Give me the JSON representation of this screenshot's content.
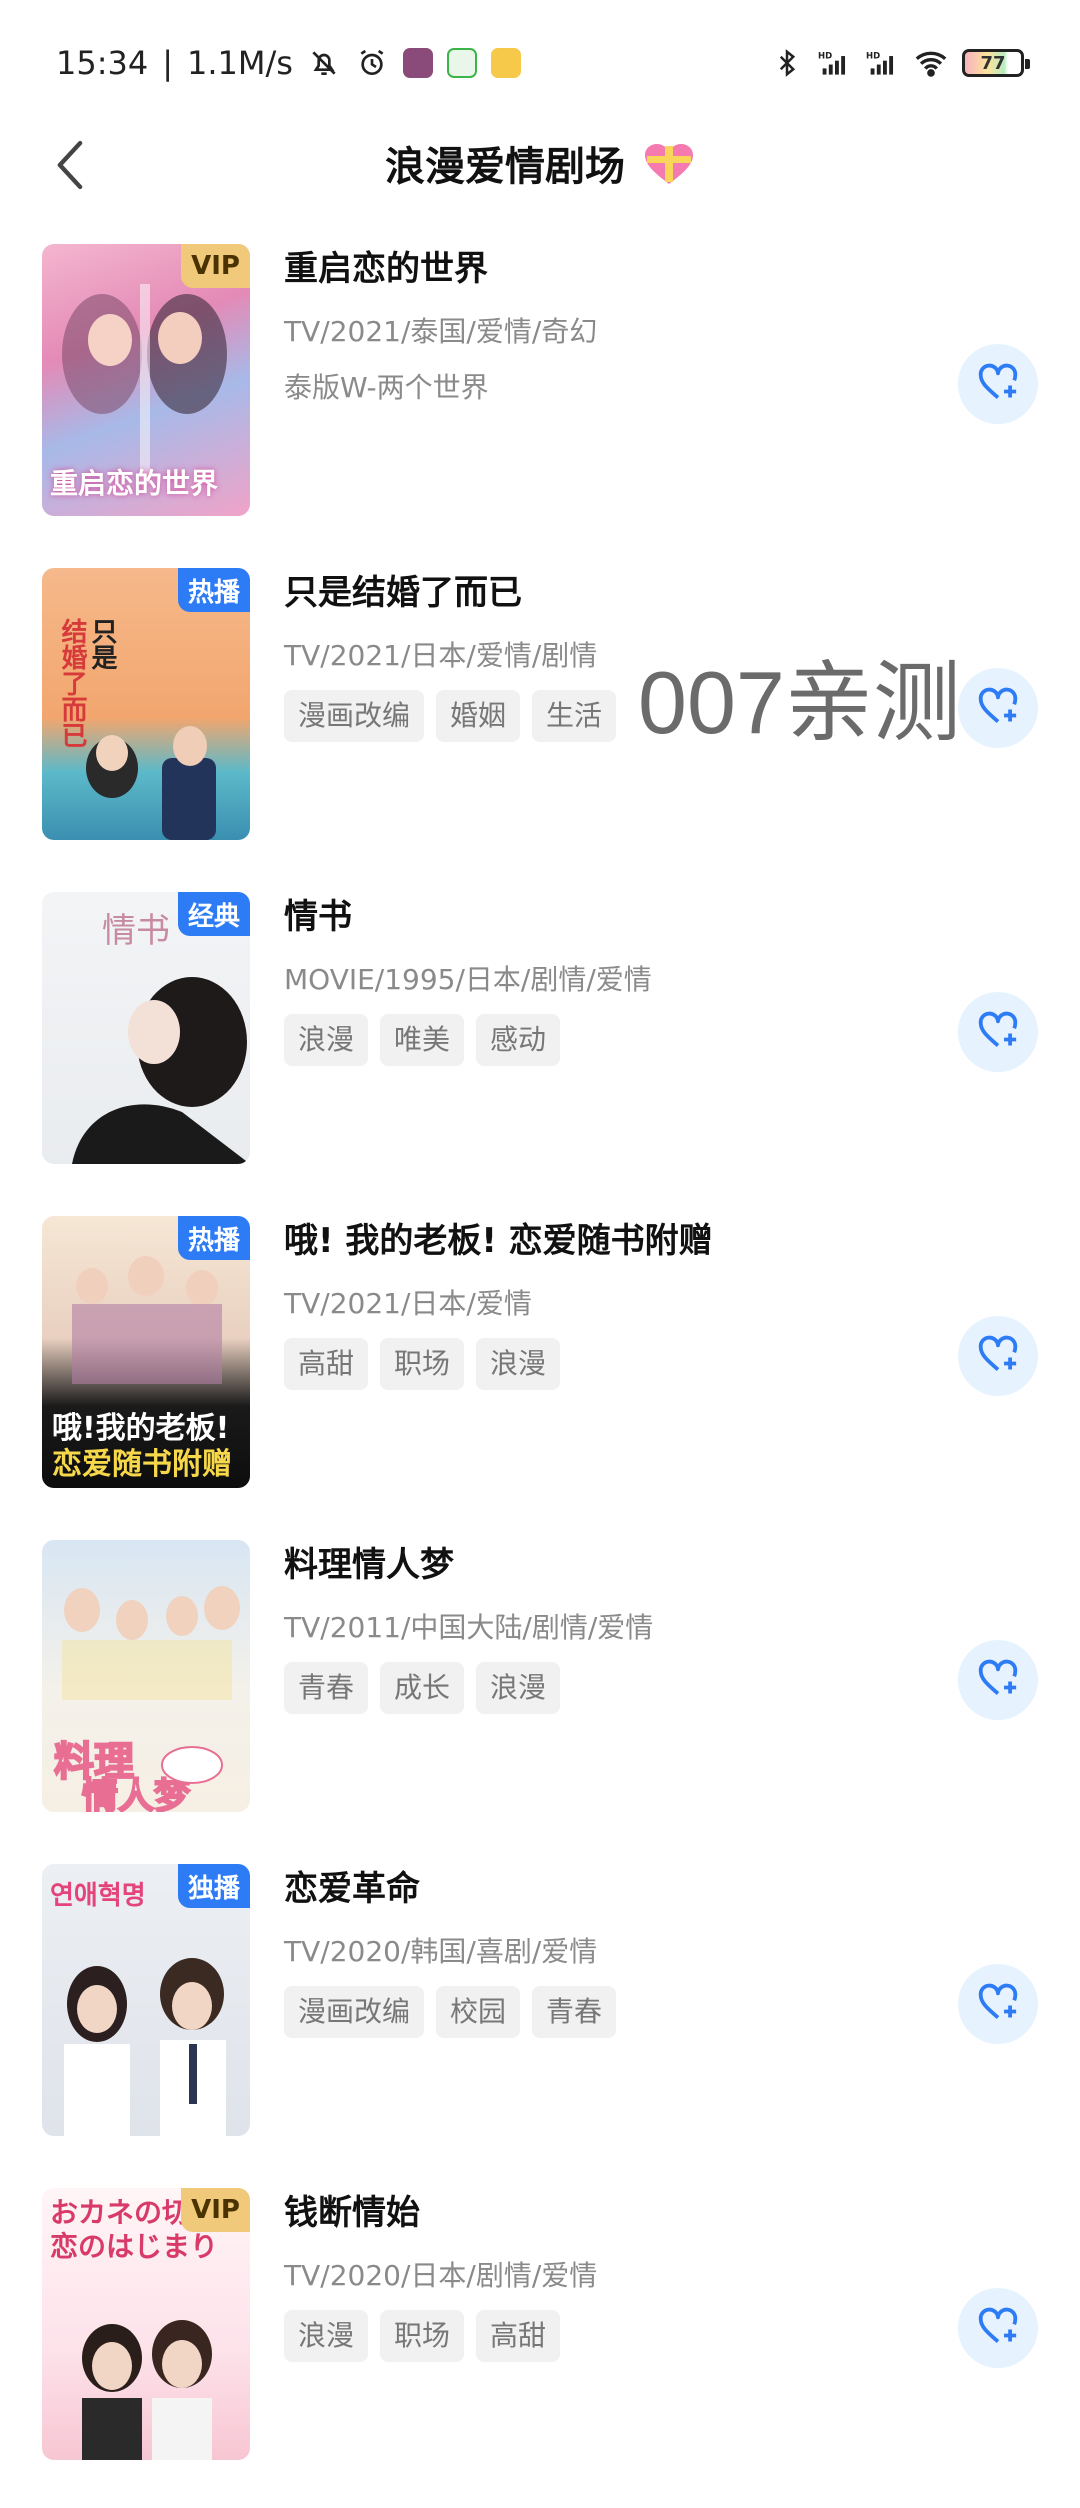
{
  "status": {
    "time": "15:34",
    "speed": "1.1M/s",
    "battery": "77"
  },
  "nav": {
    "title": "浪漫爱情剧场"
  },
  "watermark": "007亲测",
  "items": [
    {
      "title": "重启恋的世界",
      "meta": "TV/2021/泰国/爱情/奇幻",
      "alias": "泰版W-两个世界",
      "badge": "VIP",
      "poster_text": "重启恋的世界",
      "tags": []
    },
    {
      "title": "只是结婚了而已",
      "meta": "TV/2021/日本/爱情/剧情",
      "badge": "热播",
      "tags": [
        "漫画改编",
        "婚姻",
        "生活"
      ]
    },
    {
      "title": "情书",
      "meta": "MOVIE/1995/日本/剧情/爱情",
      "badge": "经典",
      "tags": [
        "浪漫",
        "唯美",
        "感动"
      ]
    },
    {
      "title": "哦! 我的老板! 恋爱随书附赠",
      "meta": "TV/2021/日本/爱情",
      "badge": "热播",
      "tags": [
        "高甜",
        "职场",
        "浪漫"
      ]
    },
    {
      "title": "料理情人梦",
      "meta": "TV/2011/中国大陆/剧情/爱情",
      "badge": "",
      "tags": [
        "青春",
        "成长",
        "浪漫"
      ]
    },
    {
      "title": "恋爱革命",
      "meta": "TV/2020/韩国/喜剧/爱情",
      "badge": "独播",
      "tags": [
        "漫画改编",
        "校园",
        "青春"
      ]
    },
    {
      "title": "钱断情始",
      "meta": "TV/2020/日本/剧情/爱情",
      "badge": "VIP",
      "tags": [
        "浪漫",
        "职场",
        "高甜"
      ]
    }
  ],
  "icons": {
    "back": "chevron-left-icon",
    "favorite": "heart-plus-icon"
  },
  "colors": {
    "accent": "#2d7cf6",
    "fav_bg": "#e6f2fd",
    "vip": "#f0c97a"
  }
}
